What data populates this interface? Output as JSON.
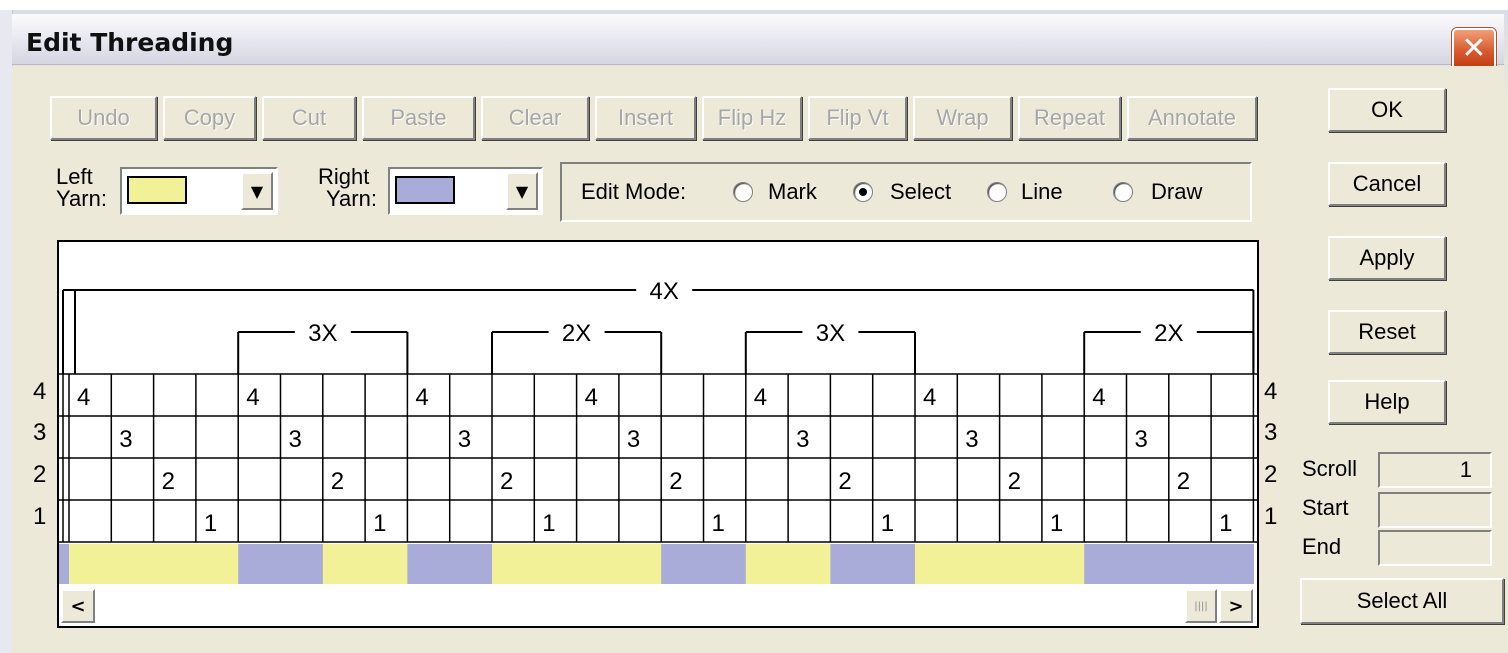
{
  "window": {
    "title": "Edit Threading",
    "close_glyph": "✕"
  },
  "toolbar": [
    {
      "label": "Undo",
      "enabled": false
    },
    {
      "label": "Copy",
      "enabled": false
    },
    {
      "label": "Cut",
      "enabled": false
    },
    {
      "label": "Paste",
      "enabled": false
    },
    {
      "label": "Clear",
      "enabled": false
    },
    {
      "label": "Insert",
      "enabled": false
    },
    {
      "label": "Flip Hz",
      "enabled": false
    },
    {
      "label": "Flip Vt",
      "enabled": false
    },
    {
      "label": "Wrap",
      "enabled": false
    },
    {
      "label": "Repeat",
      "enabled": false
    },
    {
      "label": "Annotate",
      "enabled": false
    }
  ],
  "side_buttons": {
    "ok": "OK",
    "cancel": "Cancel",
    "apply": "Apply",
    "reset": "Reset",
    "help": "Help",
    "select_all": "Select All"
  },
  "yarn": {
    "left_label_1": "Left",
    "left_label_2": "Yarn:",
    "left_color": "#f3f197",
    "right_label_1": "Right",
    "right_label_2": "Yarn:",
    "right_color": "#a9abd8"
  },
  "edit_mode": {
    "label": "Edit Mode:",
    "options": [
      {
        "label": "Mark",
        "selected": false
      },
      {
        "label": "Select",
        "selected": true
      },
      {
        "label": "Line",
        "selected": false
      },
      {
        "label": "Draw",
        "selected": false
      }
    ]
  },
  "threading": {
    "shaft_labels": [
      "4",
      "3",
      "2",
      "1"
    ],
    "columns": [
      4,
      3,
      2,
      1,
      4,
      3,
      2,
      1,
      4,
      3,
      2,
      1,
      4,
      3,
      2,
      1,
      4,
      3,
      2,
      1,
      4,
      3,
      2,
      1,
      4,
      3,
      2,
      1
    ],
    "repeats": [
      {
        "label": "4X",
        "start": 0,
        "end": 28,
        "level": 0
      },
      {
        "label": "3X",
        "start": 4,
        "end": 8,
        "level": 1
      },
      {
        "label": "2X",
        "start": 10,
        "end": 14,
        "level": 1
      },
      {
        "label": "3X",
        "start": 16,
        "end": 20,
        "level": 1
      },
      {
        "label": "2X",
        "start": 24,
        "end": 28,
        "level": 1
      }
    ],
    "yarn_colors": [
      "Y",
      "Y",
      "Y",
      "Y",
      "B",
      "B",
      "Y",
      "Y",
      "B",
      "B",
      "Y",
      "Y",
      "Y",
      "Y",
      "B",
      "B",
      "Y",
      "Y",
      "B",
      "B",
      "Y",
      "Y",
      "Y",
      "Y",
      "B",
      "B",
      "B",
      "B"
    ]
  },
  "position": {
    "scroll_label": "Scroll",
    "scroll_value": "1",
    "start_label": "Start",
    "start_value": "",
    "end_label": "End",
    "end_value": ""
  },
  "colors": {
    "yellow": "#f3f197",
    "blue": "#a9abd8"
  }
}
